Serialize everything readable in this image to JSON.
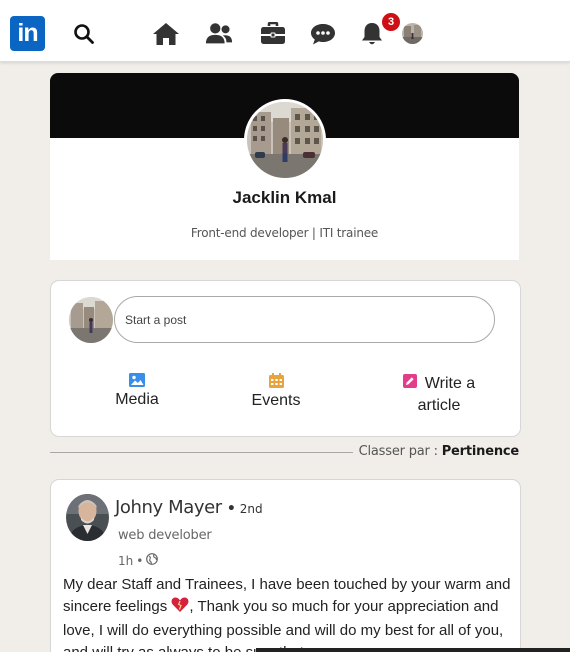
{
  "nav": {
    "logo_text": "in",
    "notification_count": "3",
    "icons": [
      "search-icon",
      "home-icon",
      "people-icon",
      "briefcase-icon",
      "chat-icon",
      "bell-icon"
    ],
    "brand_color": "#0a66c2",
    "badge_color": "#cc1016"
  },
  "profile": {
    "name": "Jacklin Kmal",
    "title": "Front-end developer | ITI trainee"
  },
  "share": {
    "placeholder": "Start a post",
    "actions": [
      {
        "label": "Media",
        "icon": "image-icon",
        "color": "#378fe9"
      },
      {
        "label": "Events",
        "icon": "calendar-icon",
        "color": "#e7a33e"
      },
      {
        "label_line1": "Write a",
        "label_line2": "article",
        "icon": "pencil-icon",
        "color": "#e23c8a"
      }
    ]
  },
  "sort": {
    "label": "Classer par :",
    "value": "Pertinence"
  },
  "post": {
    "author": "Johny Mayer",
    "degree": "2nd",
    "headline": "web develober",
    "time": "1h",
    "text_before_emoji": "My dear Staff and Trainees, I have been touched by your warm and sincere feelings",
    "text_after_emoji": ", Thank you so much for your appreciation and love, I will do everything possible and will do my best for all of you, and will try as always to be sure that  ..."
  }
}
